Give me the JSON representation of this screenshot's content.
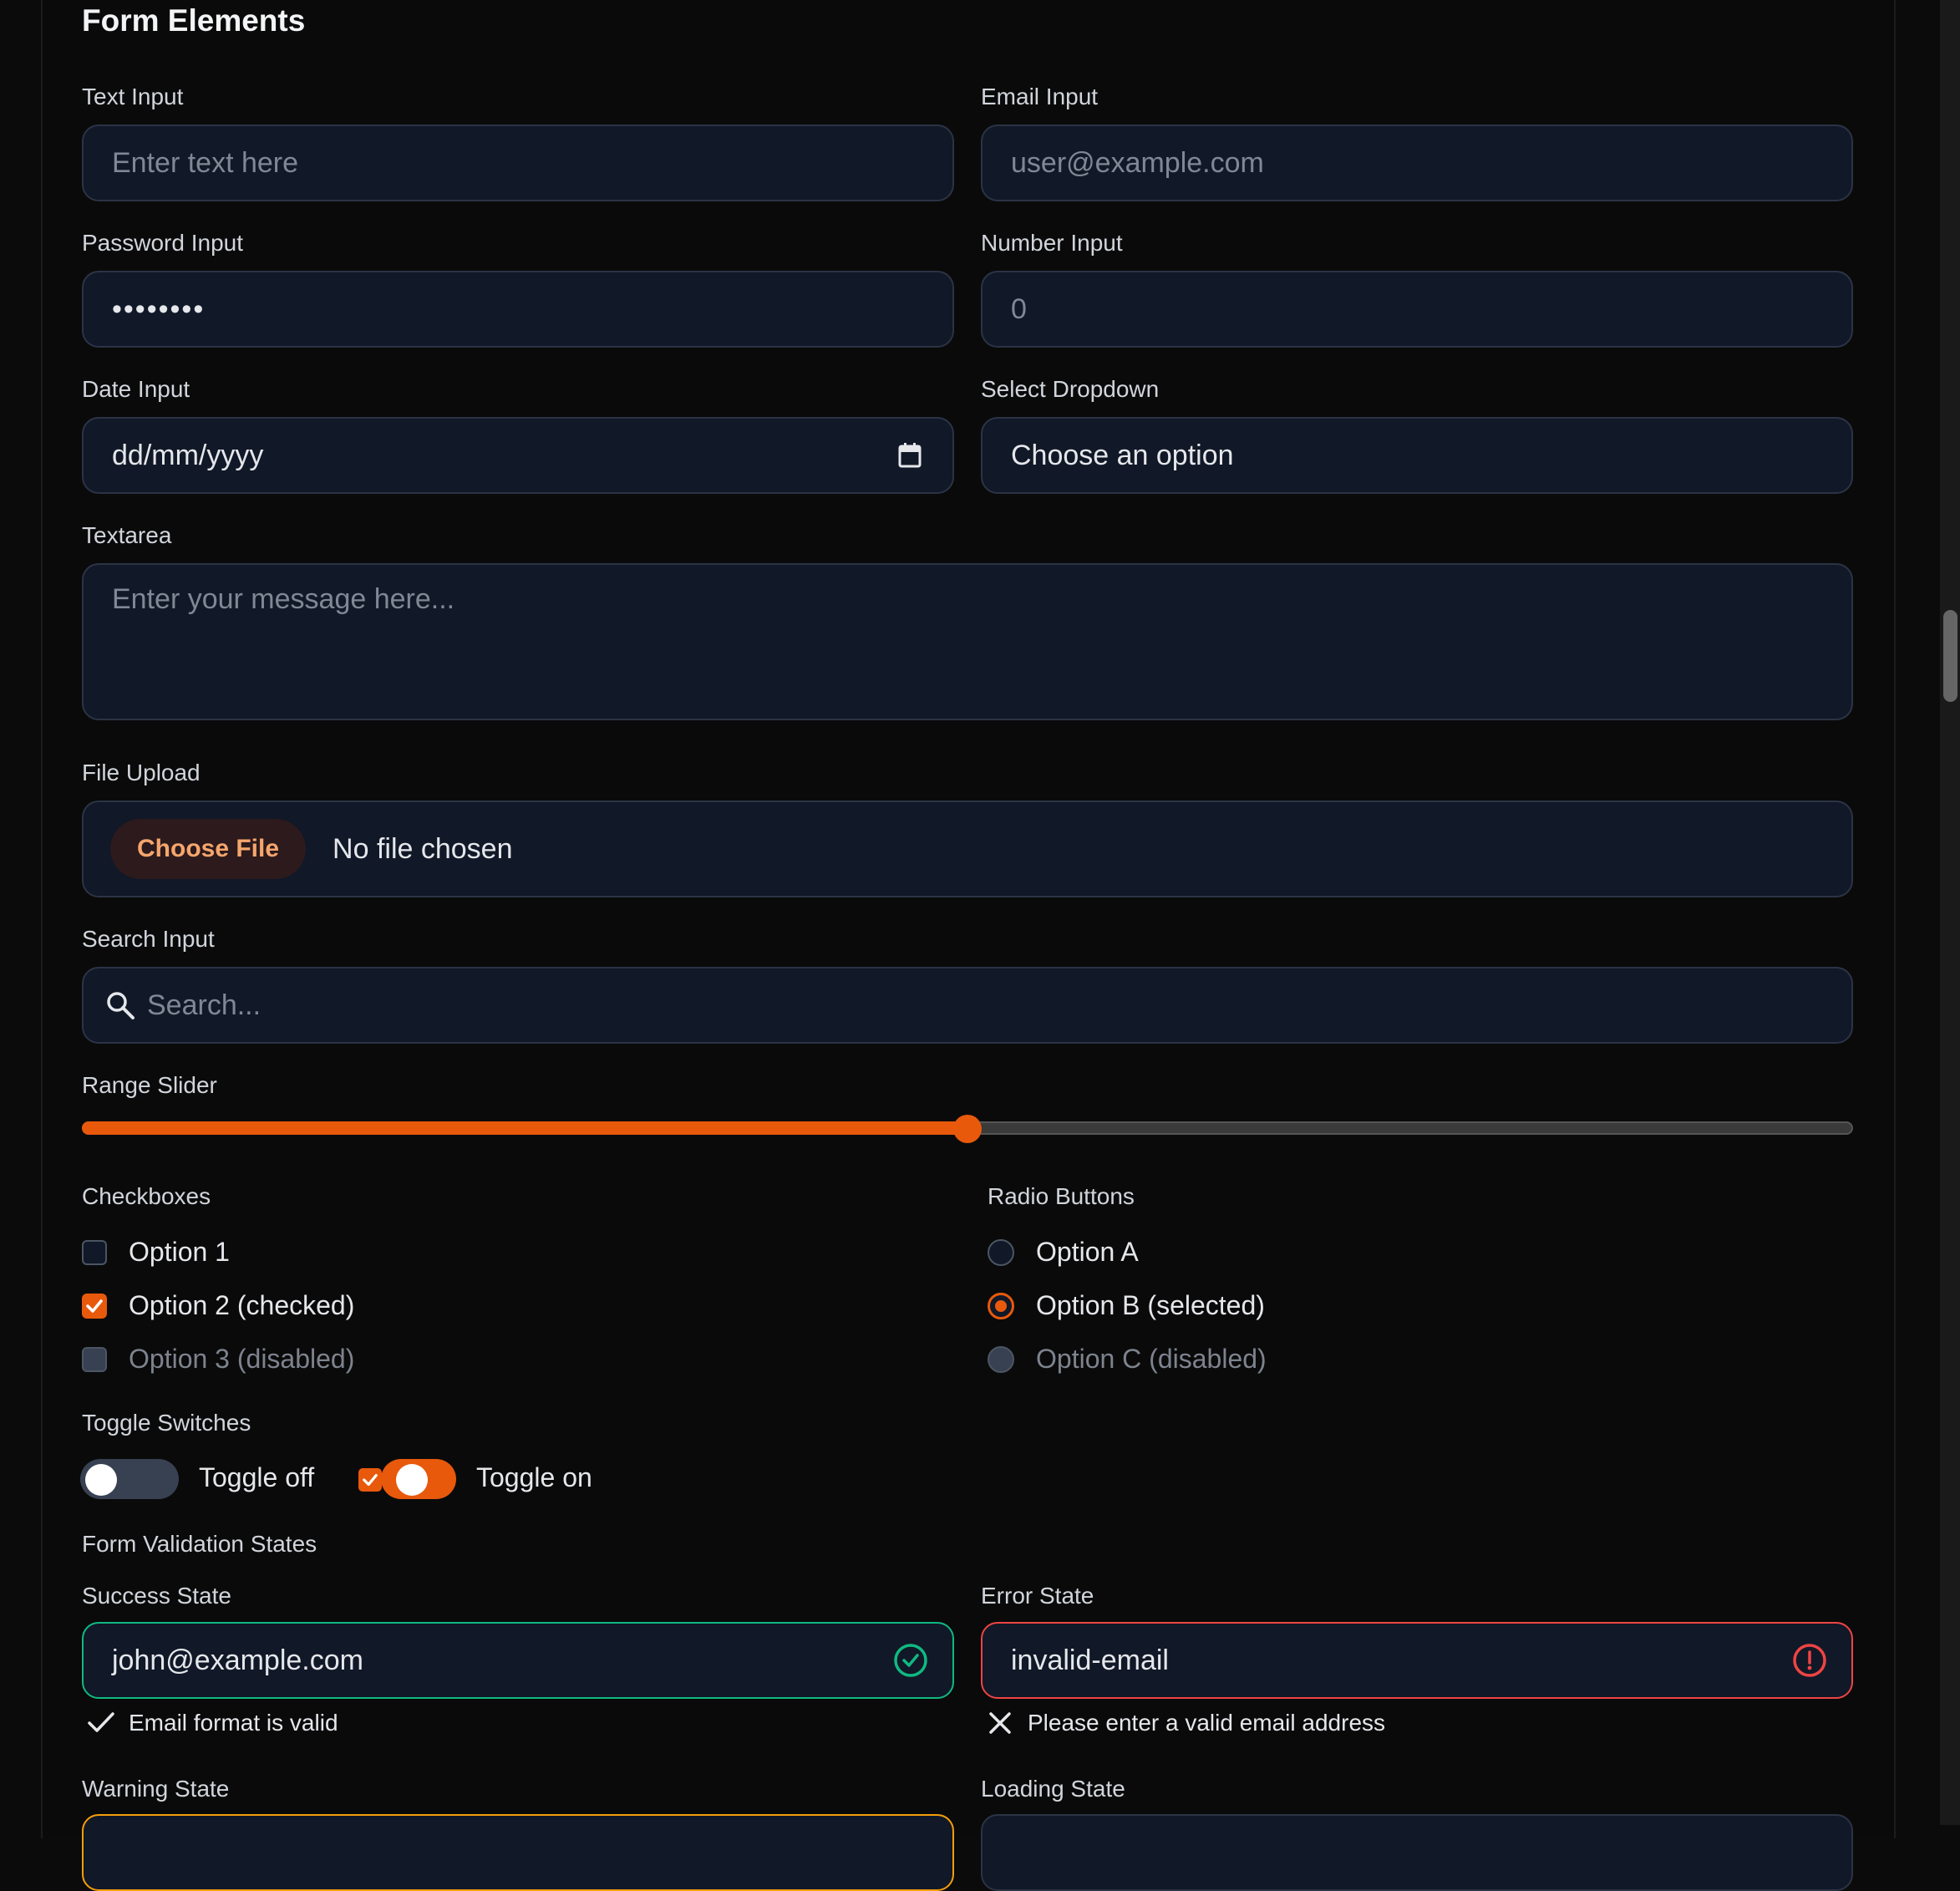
{
  "section_title": "Form Elements",
  "text_input": {
    "label": "Text Input",
    "placeholder": "Enter text here"
  },
  "email_input": {
    "label": "Email Input",
    "placeholder": "user@example.com"
  },
  "password_input": {
    "label": "Password Input",
    "value": "••••••••"
  },
  "number_input": {
    "label": "Number Input",
    "placeholder": "0"
  },
  "date_input": {
    "label": "Date Input",
    "value": "dd/mm/yyyy",
    "icon": "calendar-icon"
  },
  "select_dropdown": {
    "label": "Select Dropdown",
    "value": "Choose an option"
  },
  "textarea": {
    "label": "Textarea",
    "placeholder": "Enter your message here..."
  },
  "file_upload": {
    "label": "File Upload",
    "button": "Choose File",
    "status": "No file chosen"
  },
  "search_input": {
    "label": "Search Input",
    "placeholder": "Search...",
    "icon": "search-icon"
  },
  "range_slider": {
    "label": "Range Slider",
    "value": 0.5,
    "accent": "#e8590c"
  },
  "checkboxes": {
    "label": "Checkboxes",
    "items": [
      {
        "label": "Option 1",
        "checked": false,
        "disabled": false
      },
      {
        "label": "Option 2 (checked)",
        "checked": true,
        "disabled": false
      },
      {
        "label": "Option 3 (disabled)",
        "checked": false,
        "disabled": true
      }
    ]
  },
  "radio_buttons": {
    "label": "Radio Buttons",
    "items": [
      {
        "label": "Option A",
        "selected": false,
        "disabled": false
      },
      {
        "label": "Option B (selected)",
        "selected": true,
        "disabled": false
      },
      {
        "label": "Option C (disabled)",
        "selected": false,
        "disabled": true
      }
    ]
  },
  "toggle_switches": {
    "label": "Toggle Switches",
    "off_label": "Toggle off",
    "on_label": "Toggle on"
  },
  "validation": {
    "label": "Form Validation States",
    "success": {
      "label": "Success State",
      "value": "john@example.com",
      "message": "Email format is valid",
      "color": "#10b981"
    },
    "error": {
      "label": "Error State",
      "value": "invalid-email",
      "message": "Please enter a valid email address",
      "color": "#ef4444"
    },
    "warning": {
      "label": "Warning State",
      "color": "#f59e0b"
    },
    "loading": {
      "label": "Loading State"
    }
  }
}
